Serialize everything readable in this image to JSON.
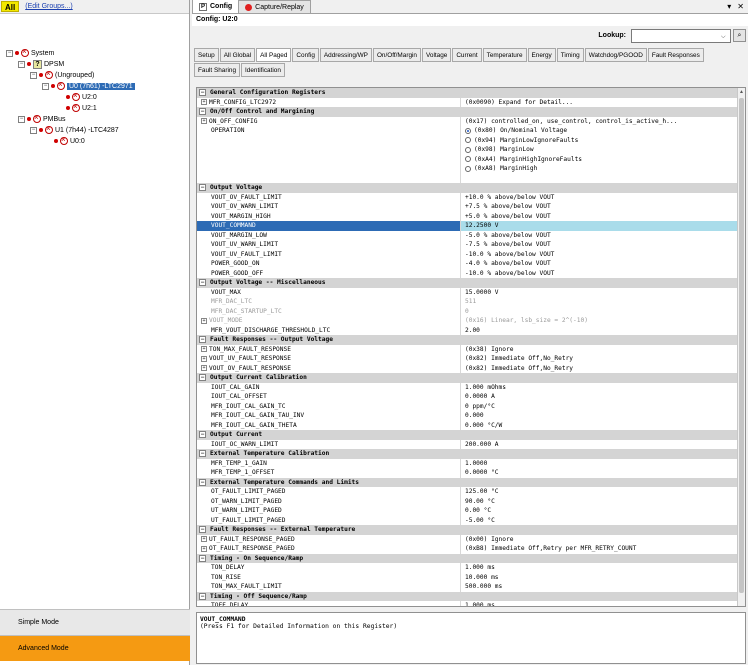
{
  "left": {
    "all_label": "All",
    "edit_groups": "(Edit Groups...)",
    "tree": {
      "system": "System",
      "dpsm": "DPSM",
      "ungrouped": "(Ungrouped)",
      "u0": "U0 (7h61) -LTC2971",
      "u20": "U2:0",
      "u21": "U2:1",
      "pmbus": "PMBus",
      "u1": "U1 (7h44) -LTC4287",
      "u00": "U0:0"
    },
    "simple_mode": "Simple Mode",
    "advanced_mode": "Advanced Mode"
  },
  "right": {
    "tab_config": "Config",
    "tab_capture": "Capture/Replay",
    "tab_p": "P",
    "config_title": "Config: U2:0",
    "lookup_label": "Lookup:",
    "lookup_value": "",
    "subtabs": [
      "Setup",
      "All Global",
      "All Paged",
      "Config",
      "Addressing/WP",
      "On/Off/Margin",
      "Voltage",
      "Current",
      "Temperature",
      "Energy",
      "Timing",
      "Watchdog/PGOOD",
      "Fault Responses",
      "Fault Sharing",
      "Identification"
    ],
    "rows": [
      {
        "t": "sec",
        "name": "General Configuration Registers"
      },
      {
        "t": "row",
        "name": "MFR_CONFIG_LTC2972",
        "val": "(0x0090) Expand for Detail...",
        "exp": true
      },
      {
        "t": "sec",
        "name": "On/Off Control and Margining"
      },
      {
        "t": "row",
        "name": "ON_OFF_CONFIG",
        "val": "(0x17)  controlled_on, use_control, control_is_active_h...",
        "exp": true
      },
      {
        "t": "op",
        "name": "OPERATION",
        "options": [
          "(0x80) On/Nominal Voltage",
          "(0x94) MarginLowIgnoreFaults",
          "(0x98) MarginLow",
          "(0xA4) MarginHighIgnoreFaults",
          "(0xA8) MarginHigh"
        ]
      },
      {
        "t": "sec",
        "name": "Output Voltage"
      },
      {
        "t": "row",
        "name": "VOUT_OV_FAULT_LIMIT",
        "val": "+10.0 % above/below VOUT"
      },
      {
        "t": "row",
        "name": "VOUT_OV_WARN_LIMIT",
        "val": "+7.5 % above/below VOUT"
      },
      {
        "t": "row",
        "name": "VOUT_MARGIN_HIGH",
        "val": "+5.0 % above/below VOUT"
      },
      {
        "t": "hl",
        "name": "VOUT_COMMAND",
        "val": "12.2500 V"
      },
      {
        "t": "row",
        "name": "VOUT_MARGIN_LOW",
        "val": "-5.0 % above/below VOUT"
      },
      {
        "t": "row",
        "name": "VOUT_UV_WARN_LIMIT",
        "val": "-7.5 % above/below VOUT"
      },
      {
        "t": "row",
        "name": "VOUT_UV_FAULT_LIMIT",
        "val": "-10.0 % above/below VOUT"
      },
      {
        "t": "row",
        "name": "POWER_GOOD_ON",
        "val": "-4.0 % above/below VOUT"
      },
      {
        "t": "row",
        "name": "POWER_GOOD_OFF",
        "val": "-10.0 % above/below VOUT"
      },
      {
        "t": "sec",
        "name": "Output Voltage -- Miscellaneous"
      },
      {
        "t": "row",
        "name": "VOUT_MAX",
        "val": "15.0000 V"
      },
      {
        "t": "dim",
        "name": "MFR_DAC_LTC",
        "val": "511"
      },
      {
        "t": "dim",
        "name": "MFR_DAC_STARTUP_LTC",
        "val": "0"
      },
      {
        "t": "dim",
        "name": "VOUT_MODE",
        "val": "(0x16) Linear, lsb_size = 2^(-10)",
        "exp": true
      },
      {
        "t": "row",
        "name": "MFR_VOUT_DISCHARGE_THRESHOLD_LTC",
        "val": "2.00"
      },
      {
        "t": "sec",
        "name": "Fault Responses -- Output Voltage"
      },
      {
        "t": "row",
        "name": "TON_MAX_FAULT_RESPONSE",
        "val": "(0x38) Ignore",
        "exp": true
      },
      {
        "t": "row",
        "name": "VOUT_UV_FAULT_RESPONSE",
        "val": "(0x82) Immediate Off,No_Retry",
        "exp": true
      },
      {
        "t": "row",
        "name": "VOUT_OV_FAULT_RESPONSE",
        "val": "(0x82) Immediate Off,No_Retry",
        "exp": true
      },
      {
        "t": "sec",
        "name": "Output Current Calibration"
      },
      {
        "t": "row",
        "name": "IOUT_CAL_GAIN",
        "val": "1.000 mOhms"
      },
      {
        "t": "row",
        "name": "IOUT_CAL_OFFSET",
        "val": "0.0000 A"
      },
      {
        "t": "row",
        "name": "MFR_IOUT_CAL_GAIN_TC",
        "val": "0 ppm/°C"
      },
      {
        "t": "row",
        "name": "MFR_IOUT_CAL_GAIN_TAU_INV",
        "val": "0.000"
      },
      {
        "t": "row",
        "name": "MFR_IOUT_CAL_GAIN_THETA",
        "val": "0.000 °C/W"
      },
      {
        "t": "sec",
        "name": "Output Current"
      },
      {
        "t": "row",
        "name": "IOUT_OC_WARN_LIMIT",
        "val": "200.000 A"
      },
      {
        "t": "sec",
        "name": "External Temperature Calibration"
      },
      {
        "t": "row",
        "name": "MFR_TEMP_1_GAIN",
        "val": "1.0000"
      },
      {
        "t": "row",
        "name": "MFR_TEMP_1_OFFSET",
        "val": "0.0000 °C"
      },
      {
        "t": "sec",
        "name": "External Temperature Commands and Limits"
      },
      {
        "t": "row",
        "name": "OT_FAULT_LIMIT_PAGED",
        "val": "125.00 °C"
      },
      {
        "t": "row",
        "name": "OT_WARN_LIMIT_PAGED",
        "val": "90.00 °C"
      },
      {
        "t": "row",
        "name": "UT_WARN_LIMIT_PAGED",
        "val": "0.00 °C"
      },
      {
        "t": "row",
        "name": "UT_FAULT_LIMIT_PAGED",
        "val": "-5.00 °C"
      },
      {
        "t": "sec",
        "name": "Fault Responses -- External Temperature"
      },
      {
        "t": "row",
        "name": "UT_FAULT_RESPONSE_PAGED",
        "val": "(0x00) Ignore",
        "exp": true
      },
      {
        "t": "row",
        "name": "OT_FAULT_RESPONSE_PAGED",
        "val": "(0xB8) Immediate Off,Retry per MFR_RETRY_COUNT",
        "exp": true
      },
      {
        "t": "sec",
        "name": "Timing - On Sequence/Ramp"
      },
      {
        "t": "row",
        "name": "TON_DELAY",
        "val": "1.000 ms"
      },
      {
        "t": "row",
        "name": "TON_RISE",
        "val": "10.000 ms"
      },
      {
        "t": "row",
        "name": "TON_MAX_FAULT_LIMIT",
        "val": "500.000 ms"
      },
      {
        "t": "sec",
        "name": "Timing - Off Sequence/Ramp"
      },
      {
        "t": "row",
        "name": "TOFF_DELAY",
        "val": "1.000 ms"
      }
    ],
    "desc_title": "VOUT_COMMAND",
    "desc_text": "(Press F1 for Detailed Information on this Register)"
  }
}
